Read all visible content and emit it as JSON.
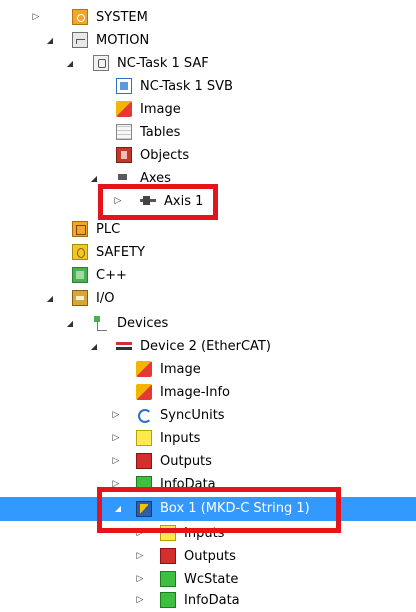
{
  "tree": {
    "system": {
      "label": "SYSTEM"
    },
    "motion": {
      "label": "MOTION"
    },
    "nc_task_saf": {
      "label": "NC-Task 1 SAF"
    },
    "nc_task_svb": {
      "label": "NC-Task 1 SVB"
    },
    "motion_image": {
      "label": "Image"
    },
    "tables": {
      "label": "Tables"
    },
    "objects": {
      "label": "Objects"
    },
    "axes": {
      "label": "Axes"
    },
    "axis1": {
      "label": "Axis 1"
    },
    "plc": {
      "label": "PLC"
    },
    "safety": {
      "label": "SAFETY"
    },
    "cpp": {
      "label": "C++"
    },
    "io": {
      "label": "I/O"
    },
    "devices": {
      "label": "Devices"
    },
    "device2": {
      "label": "Device 2 (EtherCAT)"
    },
    "dev_image": {
      "label": "Image"
    },
    "dev_image_info": {
      "label": "Image-Info"
    },
    "syncunits": {
      "label": "SyncUnits"
    },
    "dev_inputs": {
      "label": "Inputs"
    },
    "dev_outputs": {
      "label": "Outputs"
    },
    "dev_infodata": {
      "label": "InfoData"
    },
    "box1": {
      "label": "Box 1 (MKD-C String 1)",
      "selected": true
    },
    "box_inputs": {
      "label": "Inputs"
    },
    "box_outputs": {
      "label": "Outputs"
    },
    "box_wcstate": {
      "label": "WcState"
    },
    "box_infodata": {
      "label": "InfoData"
    }
  },
  "colors": {
    "selection": "#3399ff",
    "highlight_box": "#e3141c"
  }
}
